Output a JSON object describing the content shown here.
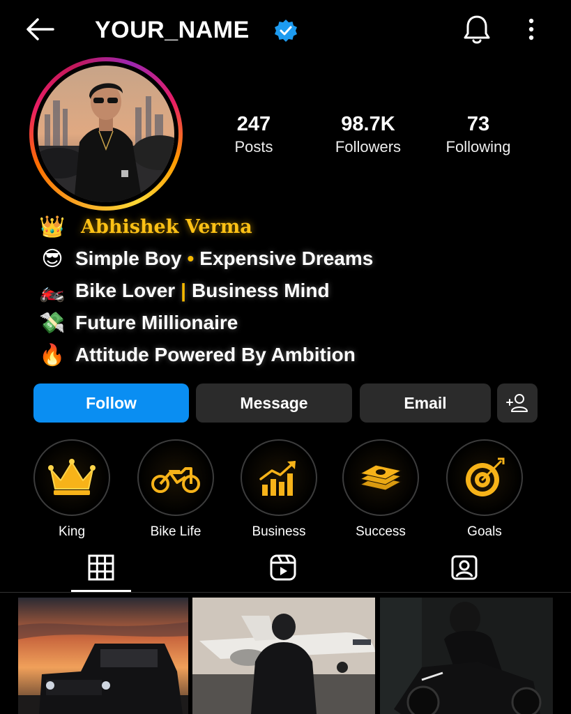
{
  "header": {
    "username": "YOUR_NAME",
    "icons": {
      "back": "arrow-left-icon",
      "verified": "verified-badge-icon",
      "notifications": "bell-icon",
      "more": "more-vertical-icon"
    }
  },
  "stats": {
    "posts": {
      "value": "247",
      "label": "Posts"
    },
    "followers": {
      "value": "98.7K",
      "label": "Followers"
    },
    "following": {
      "value": "73",
      "label": "Following"
    }
  },
  "bio": {
    "name": "Abhishek Verma",
    "name_emoji": "👑",
    "lines": [
      {
        "emoji": "😎",
        "parts": [
          "Simple Boy",
          "•",
          "Expensive Dreams"
        ]
      },
      {
        "emoji": "🏍️",
        "parts": [
          "Bike Lover",
          "|",
          "Business Mind"
        ]
      },
      {
        "emoji": "💸",
        "text": "Future Millionaire"
      },
      {
        "emoji": "🔥",
        "text": "Attitude Powered By Ambition"
      }
    ]
  },
  "actions": {
    "follow": "Follow",
    "message": "Message",
    "email": "Email",
    "add_icon": "add-person-icon"
  },
  "highlights": [
    {
      "label": "King",
      "icon": "crown-icon"
    },
    {
      "label": "Bike Life",
      "icon": "motorcycle-icon"
    },
    {
      "label": "Business",
      "icon": "growth-chart-icon"
    },
    {
      "label": "Success",
      "icon": "money-stack-icon"
    },
    {
      "label": "Goals",
      "icon": "target-icon"
    }
  ],
  "tabs": [
    {
      "icon": "grid-icon",
      "active": true
    },
    {
      "icon": "reels-icon",
      "active": false
    },
    {
      "icon": "tagged-icon",
      "active": false
    }
  ],
  "posts": [
    {
      "subject": "black-suv-at-sunset"
    },
    {
      "subject": "man-in-front-of-private-jet"
    },
    {
      "subject": "rider-on-black-sportbike"
    }
  ],
  "colors": {
    "accent_blue": "#0a8ef2",
    "verified_blue": "#1d9bf0",
    "gold": "#fdc116",
    "button_dark": "#2b2b2b",
    "background": "#000000"
  }
}
